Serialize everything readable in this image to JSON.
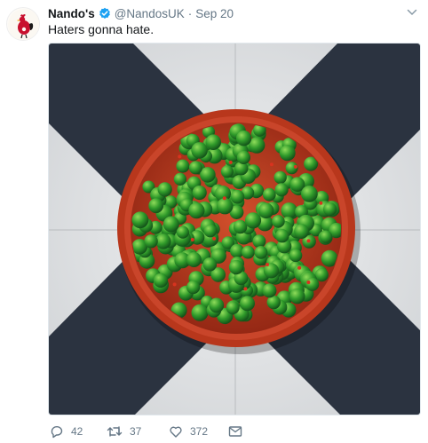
{
  "tweet": {
    "author": {
      "display_name": "Nando's",
      "handle": "@NandosUK",
      "verified": true,
      "avatar_icon": "nandos-rooster-logo"
    },
    "separator": "·",
    "timestamp": "Sep 20",
    "text": "Haters gonna hate.",
    "media": {
      "icon": "bowl-of-peas-photo"
    },
    "actions": {
      "reply": {
        "icon": "reply-icon",
        "count": "42"
      },
      "retweet": {
        "icon": "retweet-icon",
        "count": "37"
      },
      "like": {
        "icon": "heart-icon",
        "count": "372"
      },
      "dm": {
        "icon": "envelope-icon"
      }
    }
  },
  "colors": {
    "verified": "#1da1f2",
    "muted": "#657786",
    "text": "#14171a",
    "bowl": "#b8371c",
    "peas": "#2f9a2a",
    "tile_dark": "#2b3340",
    "tile_light": "#e4e6e8"
  }
}
